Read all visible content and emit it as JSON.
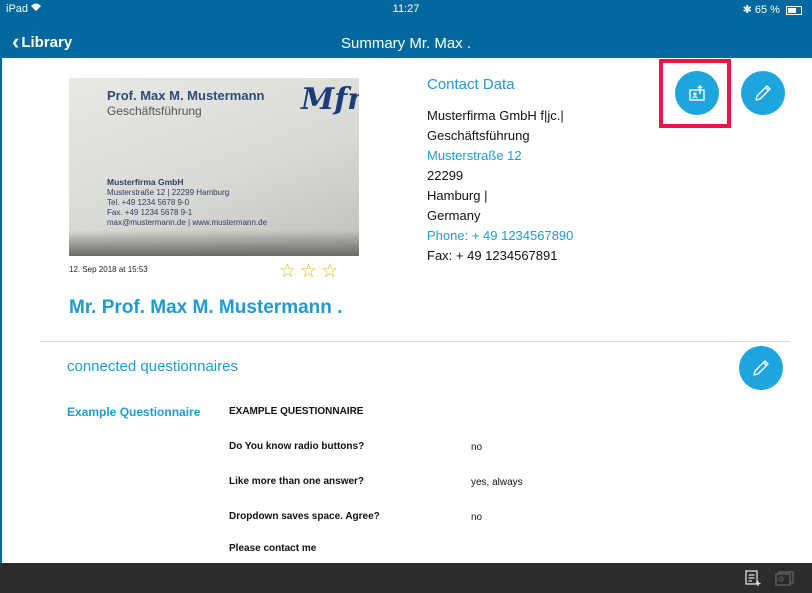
{
  "status_bar": {
    "carrier": "iPad",
    "wifi_icon": "wifi-icon",
    "time": "11:27",
    "battery": "65 %",
    "battery_level": 0.65
  },
  "nav": {
    "back_label": "Library",
    "title": "Summary Mr. Max ."
  },
  "card_image": {
    "name": "Prof. Max M. Mustermann",
    "role": "Geschäftsführung",
    "company": "Musterfirma GmbH",
    "address": "Musterstraße 12 | 22299 Hamburg",
    "tel": "Tel. +49 1234 5678 9-0",
    "fax": "Fax. +49 1234 5678 9-1",
    "web": "max@mustermann.de | www.mustermann.de",
    "logo_text": "Mfm"
  },
  "scan_date": "12. Sep 2018 at 15:53",
  "rating": {
    "stars": 3,
    "filled": 0
  },
  "person_name": "Mr. Prof. Max M. Mustermann .",
  "contact": {
    "title": "Contact Data",
    "company": "Musterfirma GmbH f|jc.|",
    "position": "Geschäftsführung",
    "street": "Musterstraße 12",
    "zip": "22299",
    "city": "Hamburg |",
    "country": "Germany",
    "phone": "Phone: + 49 1234567890",
    "fax": "Fax: + 49 1234567891"
  },
  "questionnaires": {
    "section_title": "connected questionnaires",
    "name": "Example Questionnaire",
    "heading": "EXAMPLE QUESTIONNAIRE",
    "rows": [
      {
        "question": "Do You know radio buttons?",
        "answer": "no"
      },
      {
        "question": "Like more than one answer?",
        "answer": "yes, always"
      },
      {
        "question": "Dropdown saves space. Agree?",
        "answer": "no"
      },
      {
        "question": "Please contact me",
        "answer": ""
      }
    ]
  },
  "colors": {
    "nav_blue": "#02689e",
    "accent_blue": "#1ca6dd",
    "highlight_red": "#e4194a",
    "bottom_bar": "#2c2c2c"
  }
}
